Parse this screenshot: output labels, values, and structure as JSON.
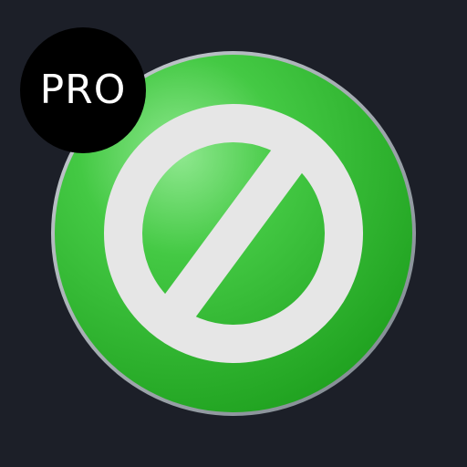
{
  "badge": {
    "label": "PRO",
    "background": "#000000",
    "text_color": "#ffffff"
  },
  "icon": {
    "name": "prohibited-icon",
    "ring_color": "#3dbf3d",
    "symbol_color": "#e6e6e6",
    "rim_color": "#9aa3ab"
  },
  "background_color": "#1c1f28"
}
